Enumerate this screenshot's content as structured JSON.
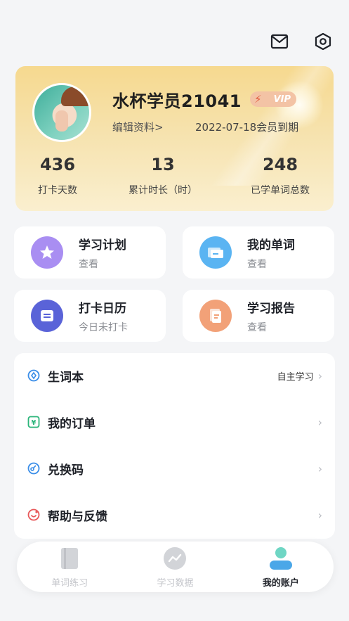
{
  "profile": {
    "username": "水杯学员21041",
    "vip_label": "VIP",
    "edit_link": "编辑资料>",
    "expire_text": "2022-07-18会员到期",
    "stats": [
      {
        "value": "436",
        "label": "打卡天数"
      },
      {
        "value": "13",
        "label": "累计时长（时）"
      },
      {
        "value": "248",
        "label": "已学单词总数"
      }
    ]
  },
  "tiles": [
    {
      "title": "学习计划",
      "sub": "查看",
      "icon": "star-icon",
      "color": "#a98ef2"
    },
    {
      "title": "我的单词",
      "sub": "查看",
      "icon": "cards-icon",
      "color": "#5ab4f2"
    },
    {
      "title": "打卡日历",
      "sub": "今日未打卡",
      "icon": "calendar-icon",
      "color": "#5a63d8"
    },
    {
      "title": "学习报告",
      "sub": "查看",
      "icon": "report-icon",
      "color": "#f2a178"
    }
  ],
  "menu": [
    {
      "label": "生词本",
      "right": "自主学习",
      "icon": "notebook-icon",
      "color": "#3b8ee8"
    },
    {
      "label": "我的订单",
      "right": "",
      "icon": "order-icon",
      "color": "#2bb57a"
    },
    {
      "label": "兑换码",
      "right": "",
      "icon": "redeem-icon",
      "color": "#3b8ee8"
    },
    {
      "label": "帮助与反馈",
      "right": "",
      "icon": "help-icon",
      "color": "#e8595a"
    }
  ],
  "tabbar": [
    {
      "label": "单词练习",
      "icon": "book-icon",
      "active": false
    },
    {
      "label": "学习数据",
      "icon": "chart-icon",
      "active": false
    },
    {
      "label": "我的账户",
      "icon": "user-icon",
      "active": true
    }
  ]
}
